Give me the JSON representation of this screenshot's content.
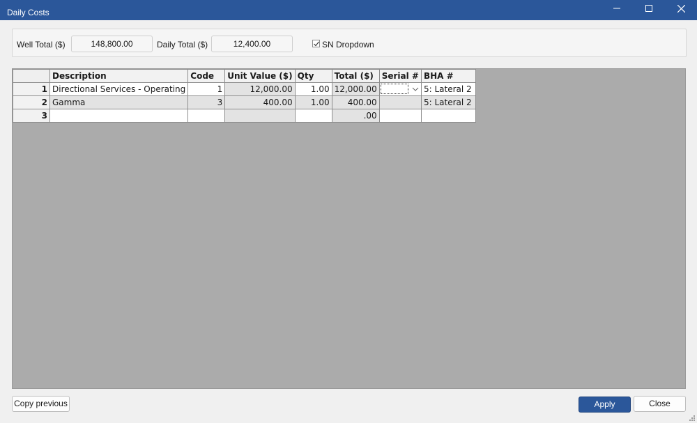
{
  "window": {
    "title": "Daily Costs",
    "icons": {
      "minimize": "minimize-icon",
      "maximize": "maximize-icon",
      "close": "close-icon"
    }
  },
  "header": {
    "well_total_label": "Well Total ($)",
    "well_total_value": "148,800.00",
    "daily_total_label": "Daily Total ($)",
    "daily_total_value": "12,400.00",
    "sn_dropdown_label": "SN Dropdown",
    "sn_dropdown_checked": true
  },
  "grid": {
    "columns": [
      "Description",
      "Code",
      "Unit Value ($)",
      "Qty",
      "Total ($)",
      "Serial #",
      "BHA #"
    ],
    "rows": [
      {
        "num": "1",
        "description": "Directional Services - Operating",
        "code": "1",
        "unit_value": "12,000.00",
        "qty": "1.00",
        "total": "12,000.00",
        "serial": "",
        "bha": "5: Lateral 2"
      },
      {
        "num": "2",
        "description": "Gamma",
        "code": "3",
        "unit_value": "400.00",
        "qty": "1.00",
        "total": "400.00",
        "serial": "",
        "bha": "5: Lateral 2"
      },
      {
        "num": "3",
        "description": "",
        "code": "",
        "unit_value": "",
        "qty": "",
        "total": ".00",
        "serial": "",
        "bha": ""
      }
    ]
  },
  "footer": {
    "copy_previous_label": "Copy previous",
    "apply_label": "Apply",
    "close_label": "Close"
  },
  "colors": {
    "accent": "#2b579a",
    "grid_background": "#ababab",
    "readonly_cell": "#e3e3e3"
  }
}
